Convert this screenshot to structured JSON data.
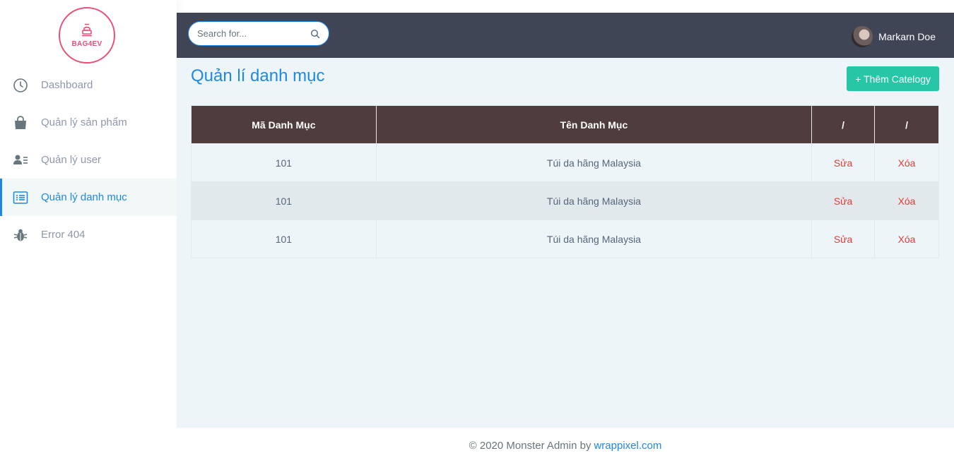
{
  "brand": {
    "logo_text": "BAG4EV"
  },
  "sidebar": {
    "items": [
      {
        "label": "Dashboard",
        "icon": "clock-icon"
      },
      {
        "label": "Quản lý sản phẩm",
        "icon": "shopping-bag-icon"
      },
      {
        "label": "Quản lý user",
        "icon": "user-list-icon"
      },
      {
        "label": "Quản lý danh mục",
        "icon": "list-icon",
        "active": true
      },
      {
        "label": "Error 404",
        "icon": "bug-icon"
      }
    ]
  },
  "topbar": {
    "search_placeholder": "Search for...",
    "user_name": "Markarn Doe"
  },
  "main": {
    "title": "Quản lí danh mục",
    "add_button": "+ Thêm Catelogy",
    "table": {
      "headers": [
        "Mã Danh Mục",
        "Tên Danh Mục",
        "/",
        "/"
      ],
      "rows": [
        {
          "id": "101",
          "name": "Túi da hãng Malaysia",
          "edit": "Sửa",
          "delete": "Xóa"
        },
        {
          "id": "101",
          "name": "Túi da hãng Malaysia",
          "edit": "Sửa",
          "delete": "Xóa"
        },
        {
          "id": "101",
          "name": "Túi da hãng Malaysia",
          "edit": "Sửa",
          "delete": "Xóa"
        }
      ]
    }
  },
  "footer": {
    "text": "© 2020 Monster Admin by",
    "link": "wrappixel.com"
  },
  "colors": {
    "accent": "#1e88e5",
    "topbar": "#404555",
    "table_header": "#4f3c3c",
    "add_button": "#26c6a7",
    "danger": "#e53935",
    "logo": "#e94e77"
  }
}
